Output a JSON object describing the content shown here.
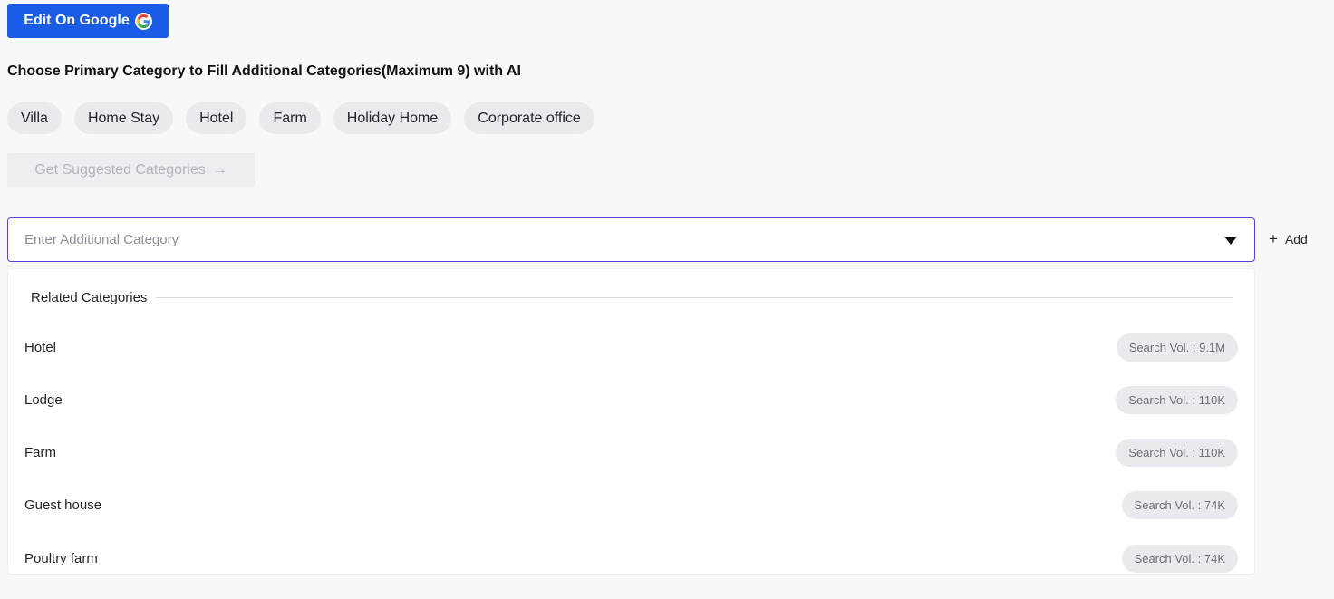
{
  "toolbar": {
    "google_button_label": "Edit On Google"
  },
  "heading": "Choose Primary Category to Fill Additional Categories(Maximum 9) with AI",
  "primary_categories": [
    "Villa",
    "Home Stay",
    "Hotel",
    "Farm",
    "Holiday Home",
    "Corporate office"
  ],
  "suggest_button": {
    "label": "Get Suggested Categories",
    "arrow": "→"
  },
  "search": {
    "placeholder": "Enter Additional Category",
    "value": ""
  },
  "add_button": {
    "icon": "+",
    "label": "Add"
  },
  "dropdown": {
    "group_title": "Related Categories",
    "options": [
      {
        "label": "Hotel",
        "volume": "Search Vol. : 9.1M"
      },
      {
        "label": "Lodge",
        "volume": "Search Vol. : 110K"
      },
      {
        "label": "Farm",
        "volume": "Search Vol. : 110K"
      },
      {
        "label": "Guest house",
        "volume": "Search Vol. : 74K"
      },
      {
        "label": "Poultry farm",
        "volume": "Search Vol. : 74K"
      }
    ]
  },
  "colors": {
    "primary": "#1a5ce6",
    "focus_border": "#5c3fd6",
    "chip_bg": "#e9eaed"
  },
  "icons": {
    "google": "google-g-icon",
    "caret": "caret-down-icon",
    "add": "plus-icon",
    "arrow": "arrow-right-icon"
  }
}
